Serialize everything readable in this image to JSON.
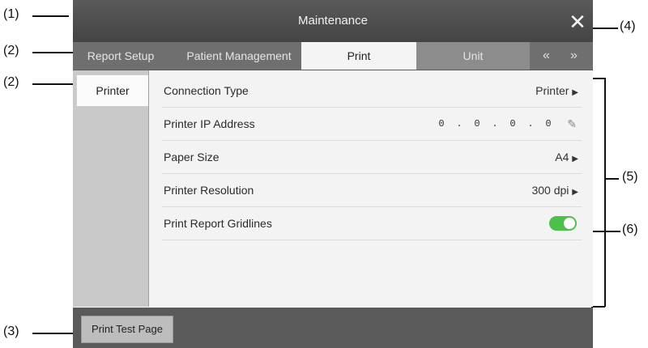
{
  "callouts": [
    "(1)",
    "(2)",
    "(2)",
    "(3)",
    "(4)",
    "(5)",
    "(6)"
  ],
  "window": {
    "title": "Maintenance",
    "close_icon": "close-icon"
  },
  "tabs": [
    {
      "label": "Report Setup"
    },
    {
      "label": "Patient Management"
    },
    {
      "label": "Print"
    },
    {
      "label": "Unit"
    }
  ],
  "tab_nav": {
    "prev": "«",
    "next": "»"
  },
  "sidebar": {
    "items": [
      {
        "label": "Printer"
      }
    ]
  },
  "settings": {
    "connection_type": {
      "label": "Connection Type",
      "value": "Printer"
    },
    "printer_ip": {
      "label": "Printer IP Address",
      "octets": [
        "0",
        "0",
        "0",
        "0"
      ],
      "separator": "."
    },
    "paper_size": {
      "label": "Paper Size",
      "value": "A4"
    },
    "resolution": {
      "label": "Printer Resolution",
      "value": "300 dpi"
    },
    "gridlines": {
      "label": "Print Report Gridlines",
      "enabled": true
    }
  },
  "footer": {
    "print_test_label": "Print Test Page"
  },
  "colors": {
    "toggle_on": "#4cc04a",
    "title_bar": "#4e4e4e"
  }
}
